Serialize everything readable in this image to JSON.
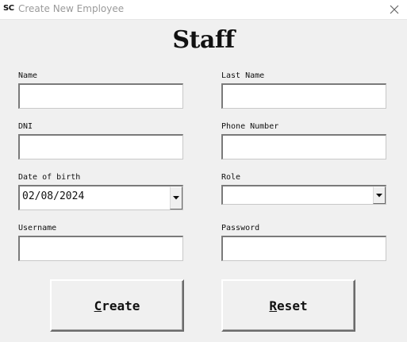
{
  "window": {
    "app_icon_text": "SC",
    "title": "Create New Employee"
  },
  "form": {
    "heading": "Staff",
    "name": {
      "label": "Name",
      "value": ""
    },
    "last_name": {
      "label": "Last Name",
      "value": ""
    },
    "dni": {
      "label": "DNI",
      "value": ""
    },
    "phone_number": {
      "label": "Phone Number",
      "value": ""
    },
    "date_of_birth": {
      "label": "Date of birth",
      "value": "02/08/2024"
    },
    "role": {
      "label": "Role",
      "value": ""
    },
    "username": {
      "label": "Username",
      "value": ""
    },
    "password": {
      "label": "Password",
      "value": ""
    }
  },
  "buttons": {
    "create": {
      "mnemonic": "C",
      "rest": "reate"
    },
    "reset": {
      "mnemonic": "R",
      "rest": "eset"
    }
  },
  "icons": {
    "close": "close-icon",
    "dropdown": "chevron-down-icon"
  }
}
